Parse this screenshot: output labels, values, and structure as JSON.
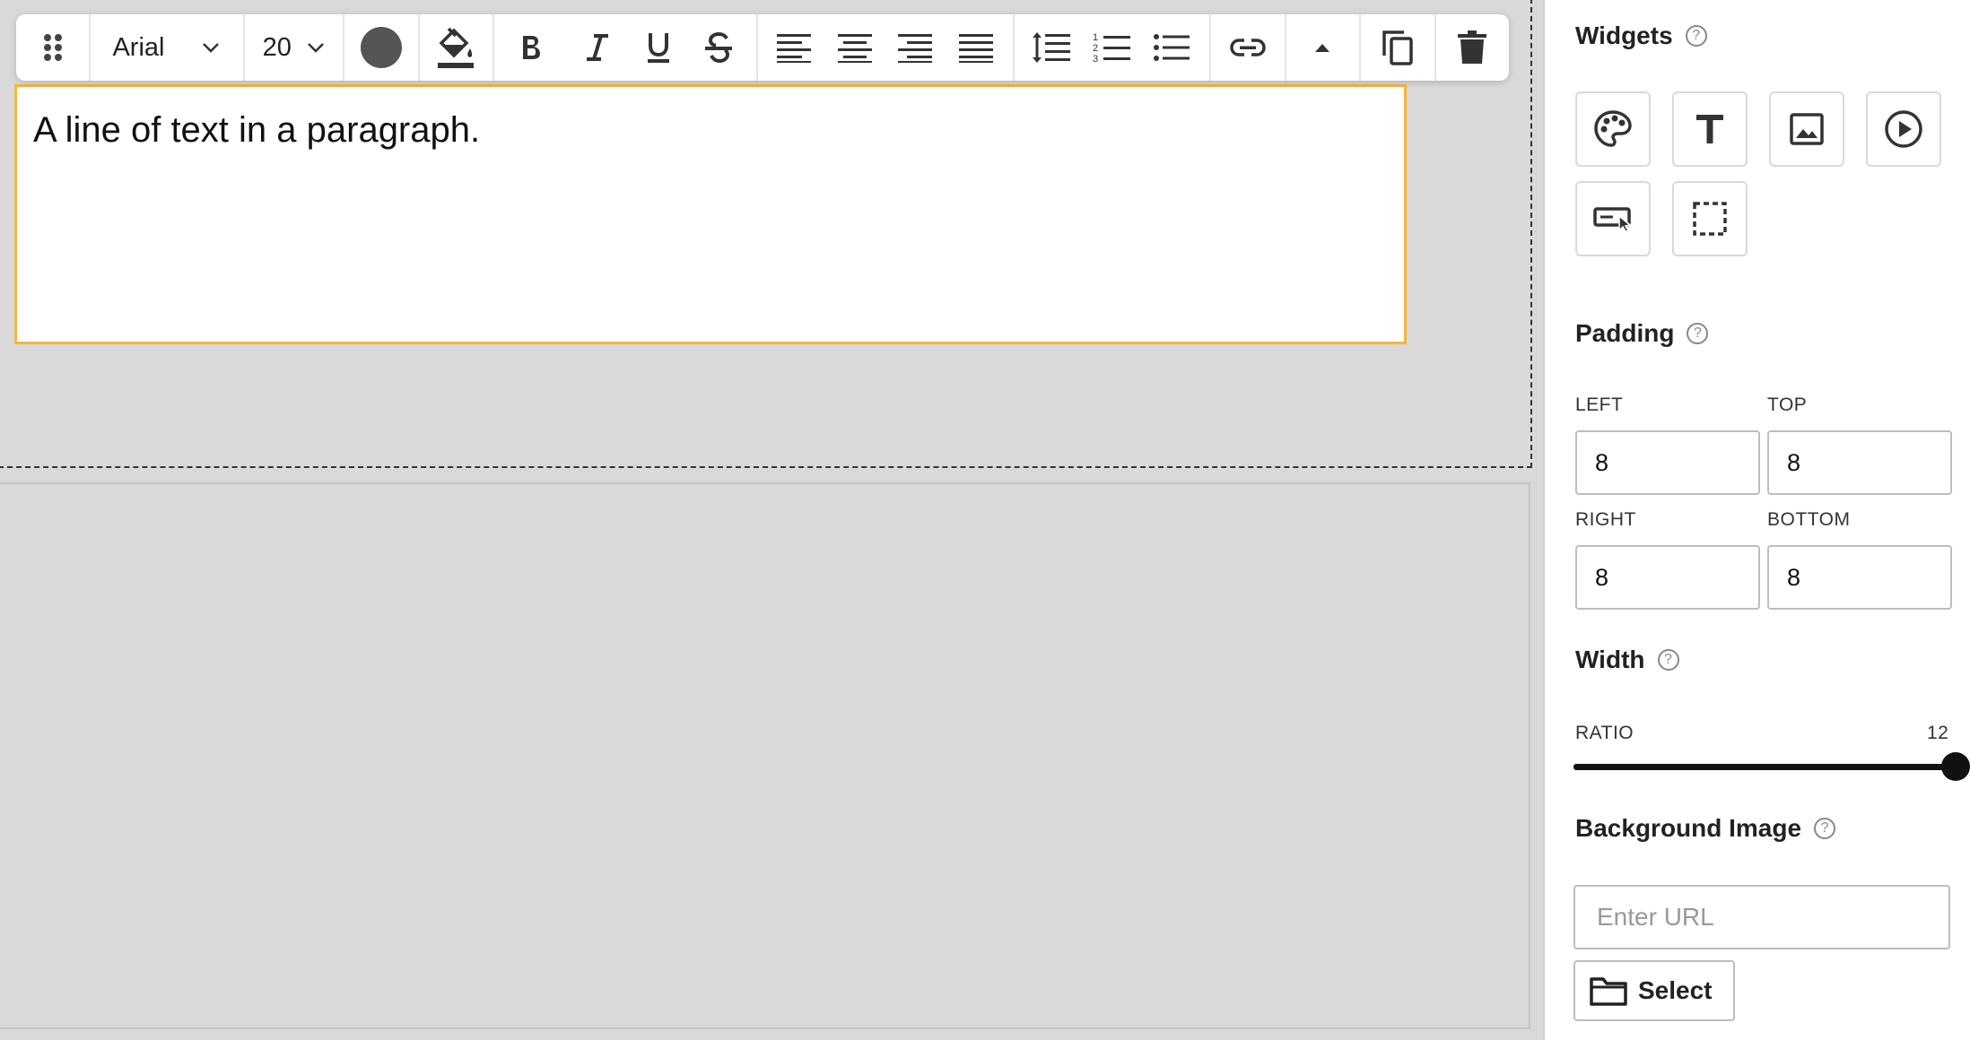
{
  "toolbar": {
    "font_family": "Arial",
    "font_size": "20",
    "text_color": "#555555",
    "icons": [
      "drag-handle-icon",
      "chevron-down-icon",
      "text-color-icon",
      "paint-bucket-icon",
      "bold-icon",
      "italic-icon",
      "underline-icon",
      "strikethrough-icon",
      "align-left-icon",
      "align-center-icon",
      "align-right-icon",
      "align-justify-icon",
      "line-height-icon",
      "ordered-list-icon",
      "unordered-list-icon",
      "link-icon",
      "caret-up-icon",
      "copy-icon",
      "trash-icon"
    ]
  },
  "editor": {
    "paragraph_text": "A line of text in a paragraph.",
    "selection_border_color": "#f4b63c"
  },
  "panel": {
    "widgets": {
      "title": "Widgets",
      "help": "?",
      "items": [
        "palette-icon",
        "text-icon",
        "image-icon",
        "video-icon",
        "button-icon",
        "spacer-icon"
      ]
    },
    "padding": {
      "title": "Padding",
      "help": "?",
      "left_label": "LEFT",
      "left_value": "8",
      "top_label": "TOP",
      "top_value": "8",
      "right_label": "RIGHT",
      "right_value": "8",
      "bottom_label": "BOTTOM",
      "bottom_value": "8"
    },
    "width": {
      "title": "Width",
      "help": "?",
      "ratio_label": "RATIO",
      "ratio_value": "12",
      "ratio_fraction": 1.0
    },
    "background_image": {
      "title": "Background Image",
      "help": "?",
      "url_placeholder": "Enter URL",
      "select_label": "Select"
    }
  }
}
